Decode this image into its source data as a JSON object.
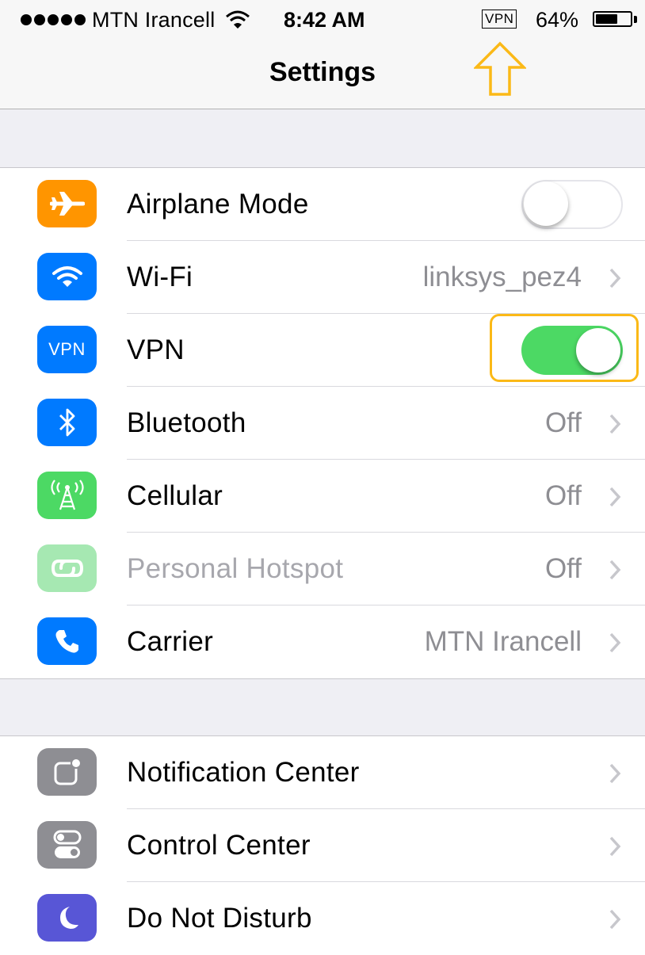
{
  "status_bar": {
    "carrier": "MTN Irancell",
    "time": "8:42 AM",
    "vpn_indicator": "VPN",
    "battery_percent": "64%",
    "battery_level": 0.64
  },
  "nav": {
    "title": "Settings"
  },
  "group1": {
    "rows": [
      {
        "label": "Airplane Mode",
        "icon": "airplane-icon",
        "icon_color": "#ff9500",
        "toggle": false
      },
      {
        "label": "Wi-Fi",
        "icon": "wifi-icon",
        "icon_color": "#007aff",
        "value": "linksys_pez4"
      },
      {
        "label": "VPN",
        "icon": "vpn-icon",
        "icon_text": "VPN",
        "icon_color": "#007aff",
        "toggle": true
      },
      {
        "label": "Bluetooth",
        "icon": "bluetooth-icon",
        "icon_color": "#007aff",
        "value": "Off"
      },
      {
        "label": "Cellular",
        "icon": "cellular-icon",
        "icon_color": "#4cd964",
        "value": "Off"
      },
      {
        "label": "Personal Hotspot",
        "icon": "hotspot-icon",
        "icon_color": "#a6e8b2",
        "value": "Off",
        "disabled": true
      },
      {
        "label": "Carrier",
        "icon": "phone-icon",
        "icon_color": "#007aff",
        "value": "MTN Irancell"
      }
    ]
  },
  "group2": {
    "rows": [
      {
        "label": "Notification Center",
        "icon": "notification-center-icon",
        "icon_color": "#8e8e93"
      },
      {
        "label": "Control Center",
        "icon": "control-center-icon",
        "icon_color": "#8e8e93"
      },
      {
        "label": "Do Not Disturb",
        "icon": "moon-icon",
        "icon_color": "#5856d6"
      }
    ]
  },
  "colors": {
    "toggle_on": "#4cd964",
    "annotation": "#fbb917"
  }
}
